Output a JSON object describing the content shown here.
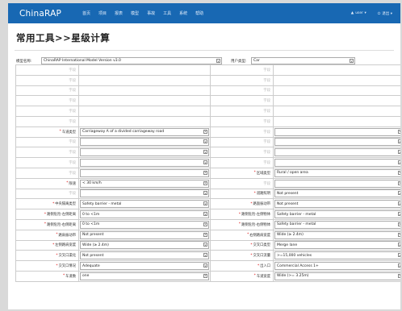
{
  "header": {
    "brand": "ChinaRAP",
    "nav": [
      "首页",
      "项目",
      "报表",
      "模型",
      "事故",
      "工具",
      "系统",
      "帮助"
    ],
    "user": "user",
    "logout": "退出"
  },
  "page_title": "常用工具>>星级计算",
  "model": {
    "label": "模型名称:",
    "value": "ChinaRAP International Model Version v3.0"
  },
  "user_type": {
    "label": "用户类型:",
    "value": "Car"
  },
  "left_rows": [
    {
      "label": "字段",
      "value": "",
      "req": false,
      "kind": "text"
    },
    {
      "label": "字段",
      "value": "",
      "req": false,
      "kind": "text"
    },
    {
      "label": "字段",
      "value": "",
      "req": false,
      "kind": "text"
    },
    {
      "label": "字段",
      "value": "",
      "req": false,
      "kind": "text"
    },
    {
      "label": "字段",
      "value": "",
      "req": false,
      "kind": "text"
    },
    {
      "label": "字段",
      "value": "",
      "req": false,
      "kind": "text"
    },
    {
      "label": "车道类型",
      "value": "Carriageway A of a divided carriageway road",
      "req": true,
      "kind": "select"
    },
    {
      "label": "字段",
      "value": "",
      "req": false,
      "kind": "select"
    },
    {
      "label": "字段",
      "value": "",
      "req": false,
      "kind": "select"
    },
    {
      "label": "字段",
      "value": "",
      "req": false,
      "kind": "select"
    },
    {
      "label": "字段",
      "value": "",
      "req": false,
      "kind": "select"
    },
    {
      "label": "限速",
      "value": "< 30 km/h",
      "req": true,
      "kind": "select"
    },
    {
      "label": "字段",
      "value": "",
      "req": false,
      "kind": "select"
    },
    {
      "label": "中央隔离类型",
      "value": "Safety barrier - metal",
      "req": true,
      "kind": "select"
    },
    {
      "label": "路侧危险-左侧距离",
      "value": "0 to <1m",
      "req": true,
      "kind": "select"
    },
    {
      "label": "路侧危险-右侧距离",
      "value": "0 to <1m",
      "req": true,
      "kind": "select"
    },
    {
      "label": "路肩振动带",
      "value": "Not present",
      "req": true,
      "kind": "select"
    },
    {
      "label": "左侧路肩宽度",
      "value": "Wide (≥ 2.4m)",
      "req": true,
      "kind": "select"
    },
    {
      "label": "交叉口渠化",
      "value": "Not present",
      "req": true,
      "kind": "select"
    },
    {
      "label": "交叉口情况",
      "value": "Adequate",
      "req": true,
      "kind": "select"
    },
    {
      "label": "车道数",
      "value": "one",
      "req": true,
      "kind": "select"
    }
  ],
  "right_rows": [
    {
      "label": "字段",
      "value": "",
      "req": false,
      "kind": "text"
    },
    {
      "label": "字段",
      "value": "",
      "req": false,
      "kind": "text"
    },
    {
      "label": "字段",
      "value": "",
      "req": false,
      "kind": "text"
    },
    {
      "label": "字段",
      "value": "",
      "req": false,
      "kind": "text"
    },
    {
      "label": "字段",
      "value": "",
      "req": false,
      "kind": "text"
    },
    {
      "label": "字段",
      "value": "",
      "req": false,
      "kind": "text"
    },
    {
      "label": "字段",
      "value": "",
      "req": false,
      "kind": "select"
    },
    {
      "label": "字段",
      "value": "",
      "req": false,
      "kind": "select"
    },
    {
      "label": "字段",
      "value": "",
      "req": false,
      "kind": "select"
    },
    {
      "label": "字段",
      "value": "",
      "req": false,
      "kind": "select"
    },
    {
      "label": "区域类型",
      "value": "Rural / open area",
      "req": true,
      "kind": "select"
    },
    {
      "label": "字段",
      "value": "",
      "req": false,
      "kind": "select"
    },
    {
      "label": "道路照明",
      "value": "Not present",
      "req": true,
      "kind": "select"
    },
    {
      "label": "路面振动带",
      "value": "Not present",
      "req": true,
      "kind": "select"
    },
    {
      "label": "路侧危险-左侧物体",
      "value": "Safety barrier - metal",
      "req": true,
      "kind": "select"
    },
    {
      "label": "路侧危险-右侧物体",
      "value": "Safety barrier - metal",
      "req": true,
      "kind": "select"
    },
    {
      "label": "右侧路肩宽度",
      "value": "Wide (≥ 2.4m)",
      "req": true,
      "kind": "select"
    },
    {
      "label": "交叉口类型",
      "value": "Merge lane",
      "req": true,
      "kind": "select"
    },
    {
      "label": "交叉口流量",
      "value": ">=15,000 vehicles",
      "req": true,
      "kind": "select"
    },
    {
      "label": "出入口",
      "value": "Commercial Access 1+",
      "req": true,
      "kind": "select"
    },
    {
      "label": "车道宽度",
      "value": "Wide (>= 3.25m)",
      "req": true,
      "kind": "select"
    }
  ]
}
